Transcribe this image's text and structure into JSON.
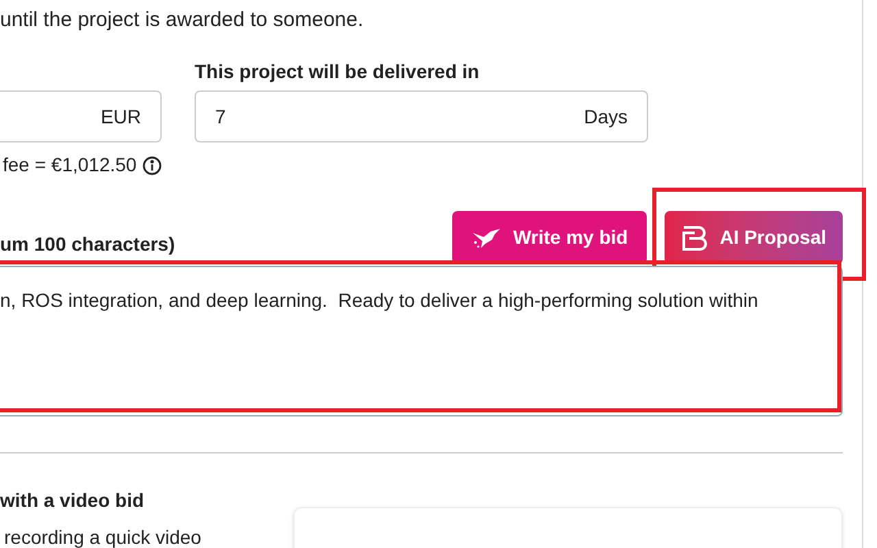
{
  "intro_text": "until the project is awarded to someone.",
  "bid_amount": {
    "suffix": "EUR",
    "fee_note": "fee = €1,012.50"
  },
  "delivery": {
    "label": "This project will be delivered in",
    "value": "7",
    "suffix": "Days"
  },
  "proposal": {
    "label": "um 100 characters)",
    "value": "n, ROS integration, and deep learning.  Ready to deliver a high-performing solution within",
    "highlighted": true
  },
  "buttons": [
    {
      "kind": "write",
      "label": "Write my bid",
      "highlighted": false
    },
    {
      "kind": "ai",
      "label": "AI Proposal",
      "highlighted": true
    }
  ],
  "video_bid": {
    "title": "with a video bid",
    "text": "recording a quick video"
  }
}
